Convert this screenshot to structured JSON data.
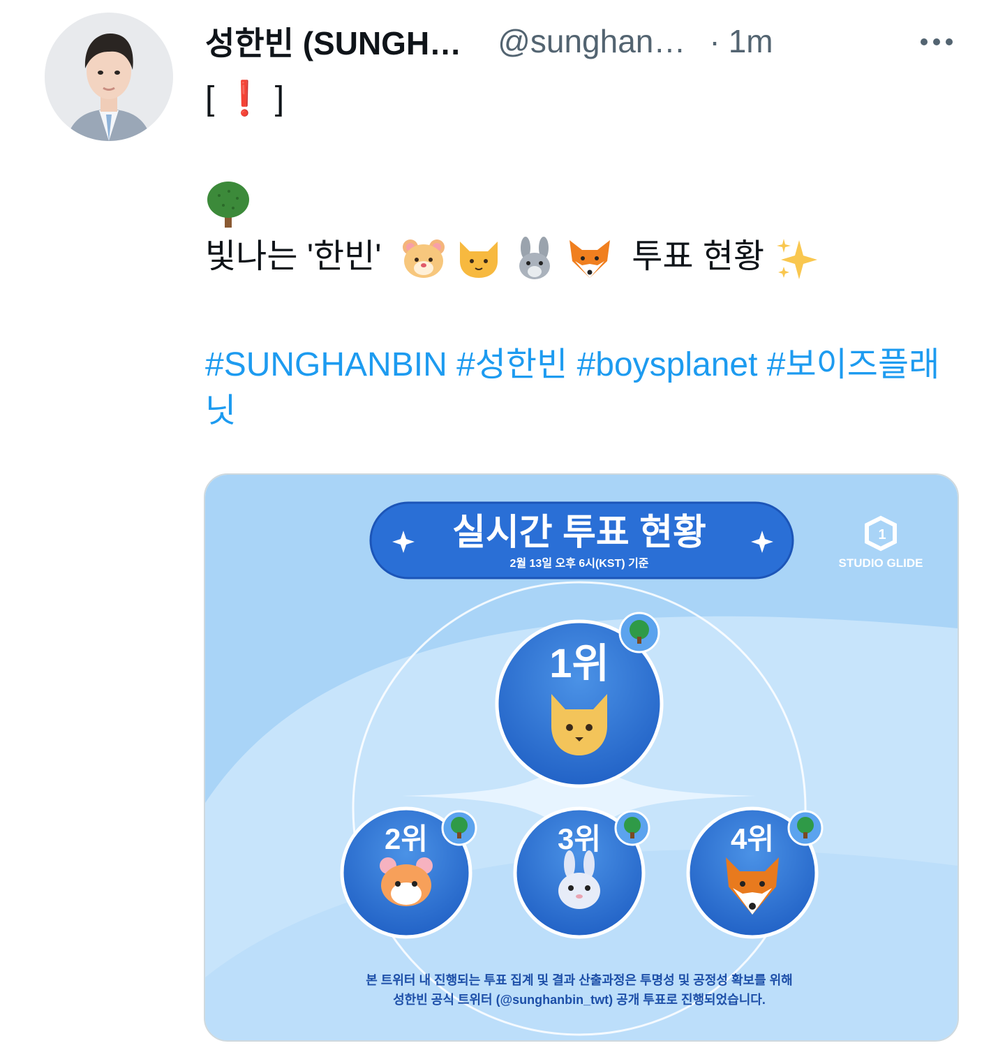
{
  "tweet": {
    "display_name": "성한빈 (SUNGH…",
    "handle": "@sunghan…",
    "separator": "·",
    "time": "1m",
    "line1": "[ ❗ ]",
    "line3_prefix": "빛나는 '한빈'",
    "line3_suffix": "투표 현황",
    "hashtags": "#SUNGHANBIN #성한빈 #boysplanet #보이즈플래닛",
    "icons": [
      "tree-emoji",
      "hamster-emoji",
      "cat-emoji",
      "rabbit-emoji",
      "fox-emoji",
      "sparkles-emoji",
      "more-options-icon"
    ]
  },
  "card": {
    "title": "실시간 투표 현황",
    "subtitle": "2월 13일 오후 6시(KST) 기준",
    "brand": "STUDIO GLIDE",
    "rank1": "1위",
    "rank2": "2위",
    "rank3": "3위",
    "rank4": "4위",
    "footer1": "본 트위터 내 진행되는 투표 집계 및 결과 산출과정은 투명성 및 공정성 확보를 위해",
    "footer2": "성한빈 공식 트위터 (@sunghanbin_twt) 공개 투표로 진행되었습니다.",
    "colors": {
      "accent": "#1d9bf0",
      "card_bg": "#a9d4f7",
      "badge_blue": "#2f77d6"
    }
  }
}
